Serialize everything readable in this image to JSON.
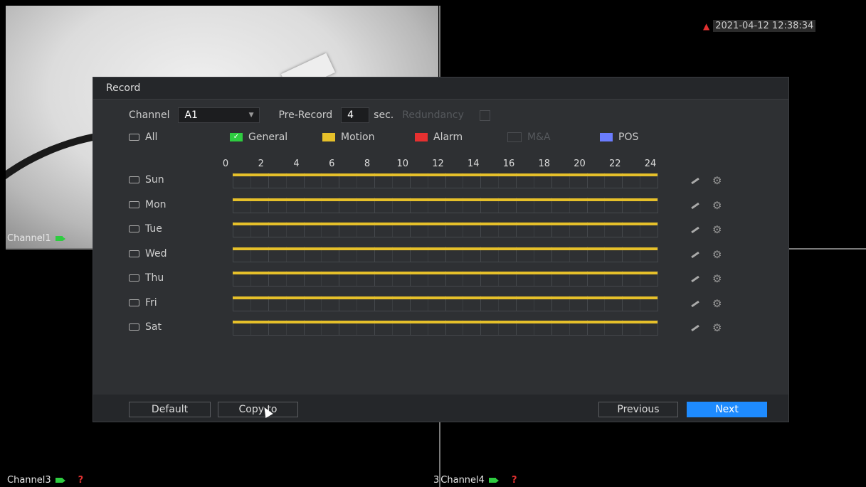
{
  "overlay": {
    "datetime": "2021-04-12 12:38:34",
    "channel1": "Channel1",
    "channel3": "Channel3",
    "channel4_prefix": "3",
    "channel4": "Channel4",
    "alert_symbol": "?"
  },
  "dialog": {
    "title": "Record",
    "channel_label": "Channel",
    "channel_value": "A1",
    "prerecord_label": "Pre-Record",
    "prerecord_value": "4",
    "prerecord_unit": "sec.",
    "redundancy_label": "Redundancy",
    "all_label": "All",
    "legend": [
      {
        "label": "General",
        "color": "#2ecc40"
      },
      {
        "label": "Motion",
        "color": "#e6c02a"
      },
      {
        "label": "Alarm",
        "color": "#e63030"
      },
      {
        "label": "M&A",
        "color": "#555"
      },
      {
        "label": "POS",
        "color": "#6b7dff"
      }
    ],
    "hours": [
      "0",
      "2",
      "4",
      "6",
      "8",
      "10",
      "12",
      "14",
      "16",
      "18",
      "20",
      "22",
      "24"
    ],
    "days": [
      "Sun",
      "Mon",
      "Tue",
      "Wed",
      "Thu",
      "Fri",
      "Sat"
    ],
    "buttons": {
      "default": "Default",
      "copy_to": "Copy to",
      "previous": "Previous",
      "next": "Next"
    }
  }
}
